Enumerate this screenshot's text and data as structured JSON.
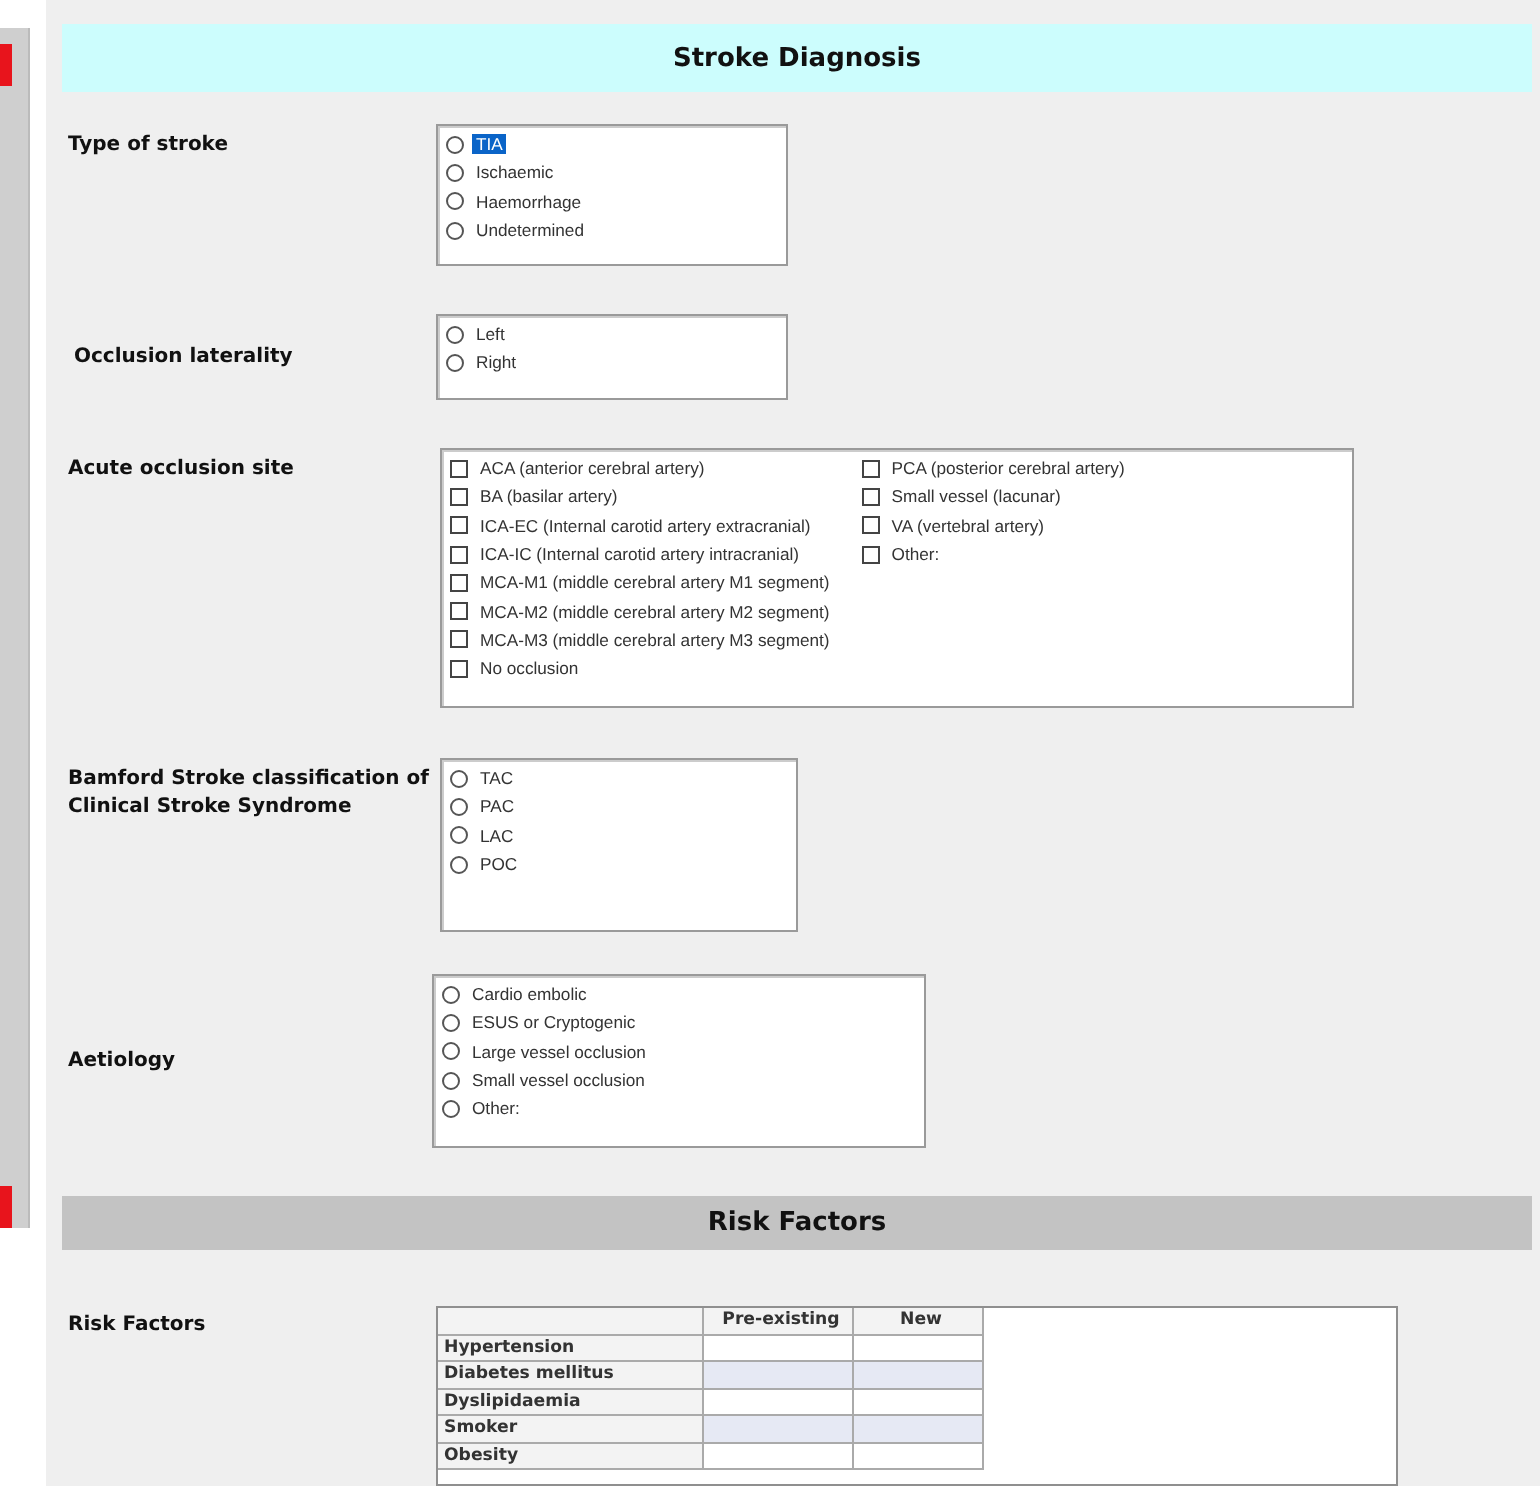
{
  "header": {
    "title": "Stroke Diagnosis"
  },
  "fields": [
    {
      "label": "Type of stroke",
      "kind": "radio",
      "columns": [
        [
          {
            "label": "TIA",
            "selected": false,
            "highlighted": true
          },
          {
            "label": "Ischaemic",
            "selected": false,
            "highlighted": false
          },
          {
            "label": "Haemorrhage",
            "selected": false,
            "highlighted": false
          },
          {
            "label": "Undetermined",
            "selected": false,
            "highlighted": false
          }
        ]
      ]
    },
    {
      "label": "Occlusion laterality",
      "kind": "radio",
      "columns": [
        [
          {
            "label": "Left",
            "selected": false,
            "highlighted": false
          },
          {
            "label": "Right",
            "selected": false,
            "highlighted": false
          }
        ]
      ]
    },
    {
      "label": "Acute occlusion site",
      "kind": "checkbox",
      "columns": [
        [
          {
            "label": "ACA (anterior cerebral artery)",
            "checked": false
          },
          {
            "label": "BA (basilar artery)",
            "checked": false
          },
          {
            "label": "ICA-EC (Internal carotid artery extracranial)",
            "checked": false
          },
          {
            "label": "ICA-IC (Internal carotid artery intracranial)",
            "checked": false
          },
          {
            "label": "MCA-M1 (middle cerebral artery M1 segment)",
            "checked": false
          },
          {
            "label": "MCA-M2 (middle cerebral artery M2 segment)",
            "checked": false
          },
          {
            "label": "MCA-M3 (middle cerebral artery M3 segment)",
            "checked": false
          },
          {
            "label": "No occlusion",
            "checked": false
          }
        ],
        [
          {
            "label": "PCA (posterior cerebral artery)",
            "checked": false
          },
          {
            "label": "Small vessel (lacunar)",
            "checked": false
          },
          {
            "label": "VA (vertebral artery)",
            "checked": false
          },
          {
            "label": "Other:",
            "checked": false
          }
        ]
      ]
    },
    {
      "label": "Bamford Stroke classification of Clinical Stroke Syndrome",
      "kind": "radio",
      "columns": [
        [
          {
            "label": "TAC",
            "selected": false,
            "highlighted": false
          },
          {
            "label": "PAC",
            "selected": false,
            "highlighted": false
          },
          {
            "label": "LAC",
            "selected": false,
            "highlighted": false
          },
          {
            "label": "POC",
            "selected": false,
            "highlighted": false
          }
        ]
      ]
    },
    {
      "label": "Aetiology",
      "kind": "radio",
      "columns": [
        [
          {
            "label": "Cardio embolic",
            "selected": false,
            "highlighted": false
          },
          {
            "label": "ESUS or Cryptogenic",
            "selected": false,
            "highlighted": false
          },
          {
            "label": "Large vessel occlusion",
            "selected": false,
            "highlighted": false
          },
          {
            "label": "Small vessel occlusion",
            "selected": false,
            "highlighted": false
          },
          {
            "label": "Other:",
            "selected": false,
            "highlighted": false
          }
        ]
      ]
    }
  ],
  "risk_header": {
    "title": "Risk Factors"
  },
  "risk_factors": {
    "label": "Risk Factors",
    "columns": [
      "Pre-existing",
      "New"
    ],
    "rows": [
      "Hypertension",
      "Diabetes mellitus",
      "Dyslipidaemia",
      "Smoker",
      "Obesity"
    ]
  }
}
